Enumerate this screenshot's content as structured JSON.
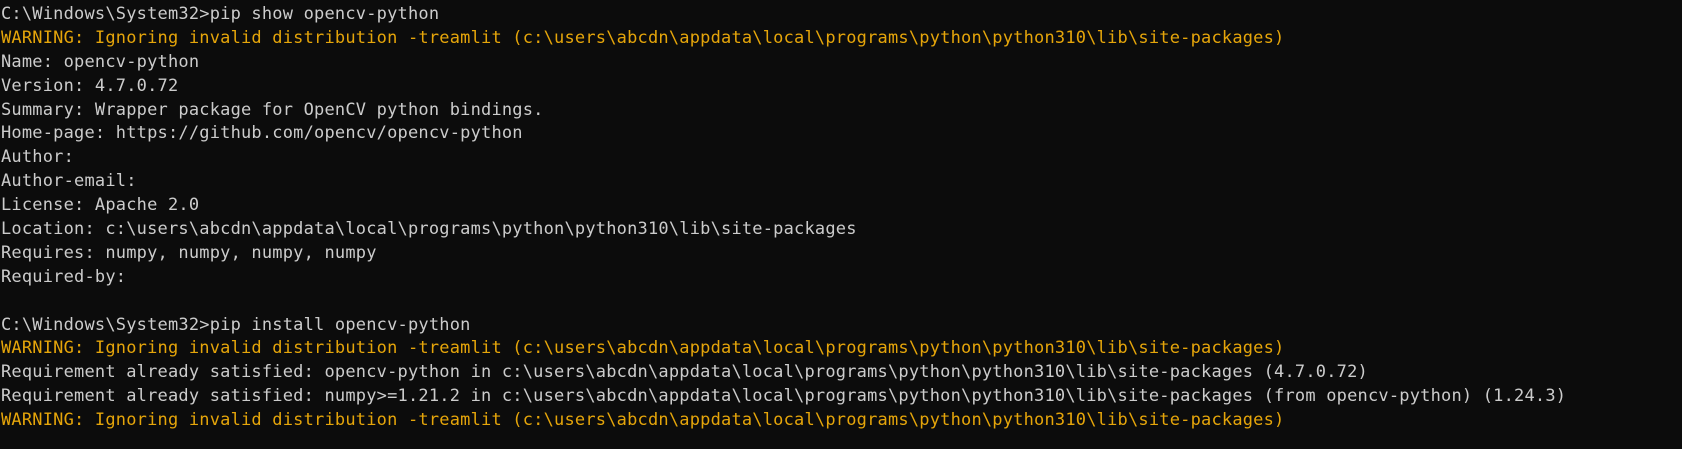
{
  "colors": {
    "background": "#0c0c0c",
    "text": "#cccccc",
    "warning": "#e5a50a"
  },
  "lines": [
    {
      "kind": "normal",
      "text": "C:\\Windows\\System32>pip show opencv-python"
    },
    {
      "kind": "warning",
      "text": "WARNING: Ignoring invalid distribution -treamlit (c:\\users\\abcdn\\appdata\\local\\programs\\python\\python310\\lib\\site-packages)"
    },
    {
      "kind": "normal",
      "text": "Name: opencv-python"
    },
    {
      "kind": "normal",
      "text": "Version: 4.7.0.72"
    },
    {
      "kind": "normal",
      "text": "Summary: Wrapper package for OpenCV python bindings."
    },
    {
      "kind": "normal",
      "text": "Home-page: https://github.com/opencv/opencv-python"
    },
    {
      "kind": "normal",
      "text": "Author:"
    },
    {
      "kind": "normal",
      "text": "Author-email:"
    },
    {
      "kind": "normal",
      "text": "License: Apache 2.0"
    },
    {
      "kind": "normal",
      "text": "Location: c:\\users\\abcdn\\appdata\\local\\programs\\python\\python310\\lib\\site-packages"
    },
    {
      "kind": "normal",
      "text": "Requires: numpy, numpy, numpy, numpy"
    },
    {
      "kind": "normal",
      "text": "Required-by:"
    },
    {
      "kind": "blank",
      "text": ""
    },
    {
      "kind": "normal",
      "text": "C:\\Windows\\System32>pip install opencv-python"
    },
    {
      "kind": "warning",
      "text": "WARNING: Ignoring invalid distribution -treamlit (c:\\users\\abcdn\\appdata\\local\\programs\\python\\python310\\lib\\site-packages)"
    },
    {
      "kind": "normal",
      "text": "Requirement already satisfied: opencv-python in c:\\users\\abcdn\\appdata\\local\\programs\\python\\python310\\lib\\site-packages (4.7.0.72)"
    },
    {
      "kind": "normal",
      "text": "Requirement already satisfied: numpy>=1.21.2 in c:\\users\\abcdn\\appdata\\local\\programs\\python\\python310\\lib\\site-packages (from opencv-python) (1.24.3)"
    },
    {
      "kind": "warning",
      "text": "WARNING: Ignoring invalid distribution -treamlit (c:\\users\\abcdn\\appdata\\local\\programs\\python\\python310\\lib\\site-packages)"
    }
  ]
}
